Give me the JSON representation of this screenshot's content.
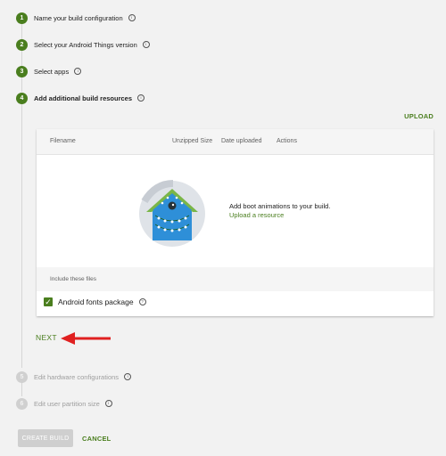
{
  "steps": [
    {
      "number": "1",
      "label": "Name your build configuration"
    },
    {
      "number": "2",
      "label": "Select your Android Things version"
    },
    {
      "number": "3",
      "label": "Select apps"
    },
    {
      "number": "4",
      "label": "Add additional build resources"
    },
    {
      "number": "5",
      "label": "Edit hardware configurations"
    },
    {
      "number": "6",
      "label": "Edit user partition size"
    }
  ],
  "upload_label": "UPLOAD",
  "table": {
    "columns": [
      "Filename",
      "Unzipped Size",
      "Date uploaded",
      "Actions"
    ],
    "empty_message": "Add boot animations to your build.",
    "empty_link": "Upload a resource"
  },
  "include_title": "Include these files",
  "fonts_package": {
    "label": "Android fonts package",
    "checked": true
  },
  "next_label": "NEXT",
  "create_build_label": "CREATE BUILD",
  "cancel_label": "CANCEL",
  "colors": {
    "accent_green": "#4a7e1e",
    "arrow_red": "#e02020",
    "illustration_blue": "#2e8fd8",
    "illustration_roof": "#7ab648"
  },
  "icons": [
    "info-icon",
    "help-icon",
    "check-icon",
    "house-illustration",
    "red-arrow"
  ]
}
